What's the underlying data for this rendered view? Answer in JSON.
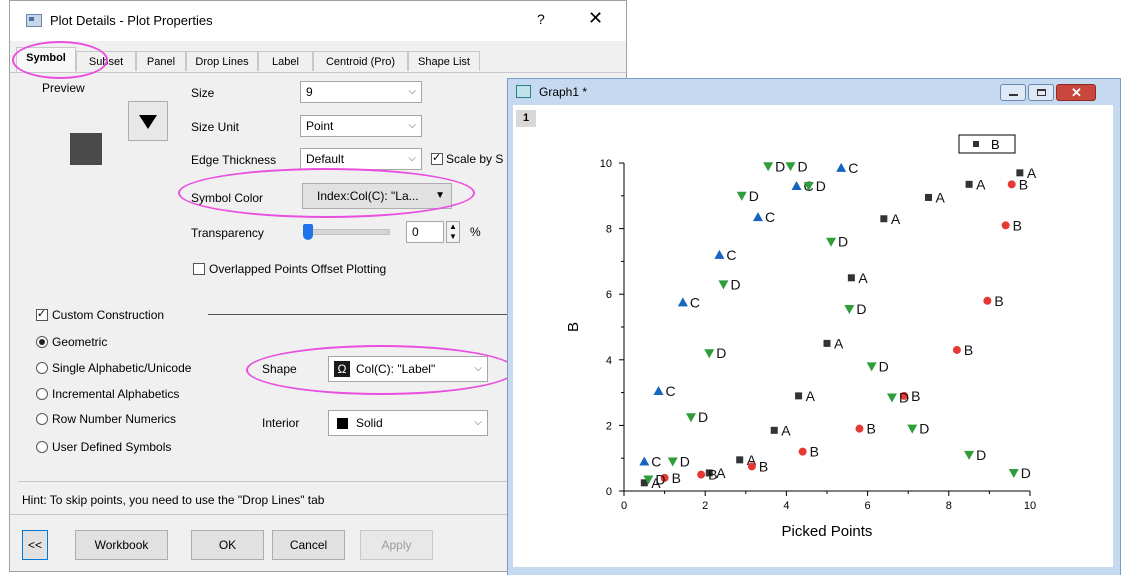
{
  "dialog": {
    "title": "Plot Details - Plot Properties",
    "help": "?",
    "close": "✕",
    "tabs": [
      "Symbol",
      "Subset",
      "Panel",
      "Drop Lines",
      "Label",
      "Centroid (Pro)",
      "Shape List"
    ],
    "preview_label": "Preview",
    "size_label": "Size",
    "size_value": "9",
    "size_unit_label": "Size Unit",
    "size_unit_value": "Point",
    "edge_thickness_label": "Edge Thickness",
    "edge_thickness_value": "Default",
    "scale_by_size_label": "Scale by S",
    "symbol_color_label": "Symbol Color",
    "symbol_color_value": "Index:Col(C): \"La...",
    "transparency_label": "Transparency",
    "transparency_value": "0",
    "transparency_unit": "%",
    "overlapped_label": "Overlapped Points Offset Plotting",
    "custom_construction_label": "Custom Construction",
    "radios": [
      "Geometric",
      "Single Alphabetic/Unicode",
      "Incremental Alphabetics",
      "Row Number Numerics",
      "User Defined Symbols"
    ],
    "shape_label": "Shape",
    "shape_value": "Col(C): \"Label\"",
    "interior_label": "Interior",
    "interior_value": "Solid",
    "hint": "Hint: To skip points, you need to use the \"Drop Lines\" tab",
    "buttons": {
      "collapse": "<<",
      "workbook": "Workbook",
      "ok": "OK",
      "cancel": "Cancel",
      "apply": "Apply"
    }
  },
  "graph_window": {
    "title": "Graph1 *",
    "layer": "1"
  },
  "chart_data": {
    "type": "scatter",
    "xlabel": "Picked Points",
    "ylabel": "B",
    "xlim": [
      0,
      10
    ],
    "ylim": [
      0,
      10
    ],
    "xticks": [
      "0",
      "2",
      "4",
      "6",
      "8",
      "10"
    ],
    "yticks": [
      "0",
      "2",
      "4",
      "6",
      "8",
      "10"
    ],
    "legend": {
      "position": "top-right",
      "label": "B"
    },
    "colors": {
      "A": "#333333",
      "B": "#e53935",
      "C": "#1565c0",
      "D": "#2e9d3a"
    },
    "marker_shapes": {
      "A": "square",
      "B": "circle",
      "C": "triangle-up",
      "D": "triangle-down"
    },
    "series": [
      {
        "name": "A",
        "points": [
          [
            0.5,
            0.25
          ],
          [
            2.1,
            0.55
          ],
          [
            2.85,
            0.95
          ],
          [
            3.7,
            1.85
          ],
          [
            4.3,
            2.9
          ],
          [
            5.0,
            4.5
          ],
          [
            5.6,
            6.5
          ],
          [
            6.4,
            8.3
          ],
          [
            7.5,
            8.95
          ],
          [
            8.5,
            9.35
          ],
          [
            9.75,
            9.7
          ]
        ]
      },
      {
        "name": "B",
        "points": [
          [
            1.0,
            0.4
          ],
          [
            1.9,
            0.5
          ],
          [
            3.15,
            0.75
          ],
          [
            4.4,
            1.2
          ],
          [
            5.8,
            1.9
          ],
          [
            6.9,
            2.9
          ],
          [
            8.2,
            4.3
          ],
          [
            8.95,
            5.8
          ],
          [
            9.4,
            8.1
          ],
          [
            9.55,
            9.35
          ]
        ]
      },
      {
        "name": "C",
        "points": [
          [
            0.5,
            0.9
          ],
          [
            0.85,
            3.05
          ],
          [
            1.45,
            5.75
          ],
          [
            2.35,
            7.2
          ],
          [
            3.3,
            8.35
          ],
          [
            4.25,
            9.3
          ],
          [
            5.35,
            9.85
          ]
        ]
      },
      {
        "name": "D",
        "points": [
          [
            0.6,
            0.35
          ],
          [
            1.2,
            0.9
          ],
          [
            1.65,
            2.25
          ],
          [
            2.1,
            4.2
          ],
          [
            2.45,
            6.3
          ],
          [
            2.9,
            9.0
          ],
          [
            3.55,
            9.9
          ],
          [
            4.1,
            9.9
          ],
          [
            4.55,
            9.3
          ],
          [
            5.1,
            7.6
          ],
          [
            5.55,
            5.55
          ],
          [
            6.1,
            3.8
          ],
          [
            6.6,
            2.85
          ],
          [
            7.1,
            1.9
          ],
          [
            8.5,
            1.1
          ],
          [
            9.6,
            0.55
          ]
        ]
      }
    ]
  }
}
